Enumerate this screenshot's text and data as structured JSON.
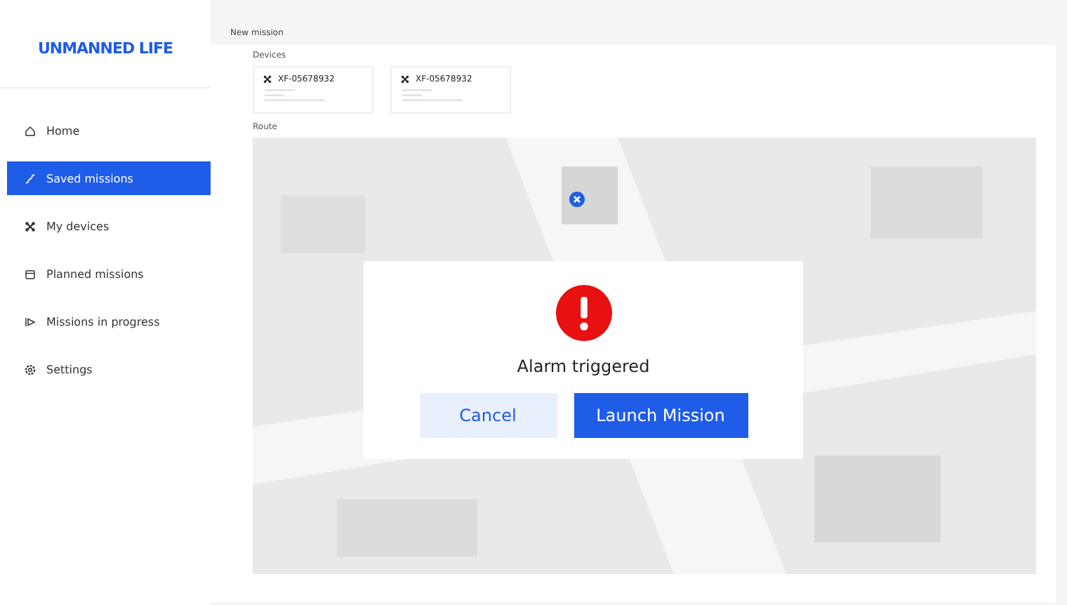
{
  "logo": "UNMANNED LIFE",
  "sidebar": {
    "items": [
      {
        "label": "Home",
        "kind": "home",
        "selected": false
      },
      {
        "label": "Saved missions",
        "kind": "route",
        "selected": true
      },
      {
        "label": "My devices",
        "kind": "drone",
        "selected": false
      },
      {
        "label": "Planned missions",
        "kind": "calendar",
        "selected": false
      },
      {
        "label": "Missions in progress",
        "kind": "play",
        "selected": false
      },
      {
        "label": "Settings",
        "kind": "gear",
        "selected": false
      }
    ]
  },
  "page_title": "New mission",
  "devices": {
    "label": "Devices",
    "items": [
      {
        "id": "XF-05678932"
      },
      {
        "id": "XF-05678932"
      }
    ]
  },
  "route": {
    "label": "Route"
  },
  "dialog": {
    "message": "Alarm triggered",
    "buttons": [
      {
        "label": "Cancel",
        "kind": "secondary"
      },
      {
        "label": "Launch Mission",
        "kind": "primary"
      }
    ]
  }
}
